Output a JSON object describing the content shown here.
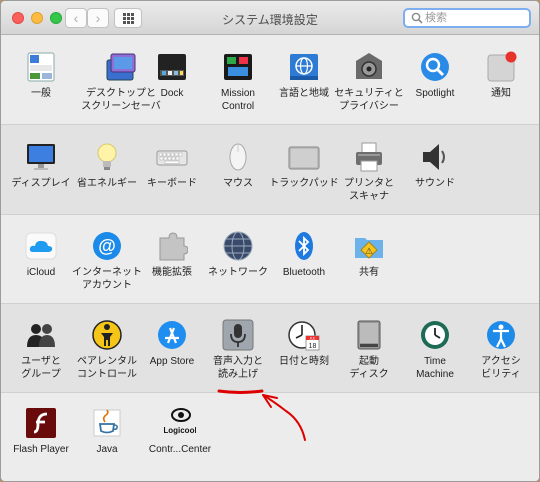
{
  "window": {
    "title": "システム環境設定"
  },
  "toolbar": {
    "back_label": "‹",
    "forward_label": "›"
  },
  "search": {
    "placeholder": "検索",
    "value": ""
  },
  "sections": [
    {
      "panes": [
        {
          "label": "一般",
          "icon": "general-icon"
        },
        {
          "label": "デスクトップと\nスクリーンセーバ",
          "icon": "desktop-screensaver-icon"
        },
        {
          "label": "Dock",
          "icon": "dock-icon"
        },
        {
          "label": "Mission\nControl",
          "icon": "mission-control-icon"
        },
        {
          "label": "言語と地域",
          "icon": "language-region-icon"
        },
        {
          "label": "セキュリティと\nプライバシー",
          "icon": "security-privacy-icon"
        },
        {
          "label": "Spotlight",
          "icon": "spotlight-icon"
        },
        {
          "label": "通知",
          "icon": "notifications-icon"
        }
      ]
    },
    {
      "panes": [
        {
          "label": "ディスプレイ",
          "icon": "displays-icon"
        },
        {
          "label": "省エネルギー",
          "icon": "energy-saver-icon"
        },
        {
          "label": "キーボード",
          "icon": "keyboard-icon"
        },
        {
          "label": "マウス",
          "icon": "mouse-icon"
        },
        {
          "label": "トラックパッド",
          "icon": "trackpad-icon"
        },
        {
          "label": "プリンタと\nスキャナ",
          "icon": "printers-scanners-icon"
        },
        {
          "label": "サウンド",
          "icon": "sound-icon"
        }
      ]
    },
    {
      "panes": [
        {
          "label": "iCloud",
          "icon": "icloud-icon"
        },
        {
          "label": "インターネット\nアカウント",
          "icon": "internet-accounts-icon"
        },
        {
          "label": "機能拡張",
          "icon": "extensions-icon"
        },
        {
          "label": "ネットワーク",
          "icon": "network-icon"
        },
        {
          "label": "Bluetooth",
          "icon": "bluetooth-icon"
        },
        {
          "label": "共有",
          "icon": "sharing-icon"
        }
      ]
    },
    {
      "panes": [
        {
          "label": "ユーザと\nグループ",
          "icon": "users-groups-icon"
        },
        {
          "label": "ペアレンタル\nコントロール",
          "icon": "parental-controls-icon"
        },
        {
          "label": "App Store",
          "icon": "app-store-icon"
        },
        {
          "label": "音声入力と\n読み上げ",
          "icon": "dictation-speech-icon"
        },
        {
          "label": "日付と時刻",
          "icon": "date-time-icon"
        },
        {
          "label": "起動\nディスク",
          "icon": "startup-disk-icon"
        },
        {
          "label": "Time\nMachine",
          "icon": "time-machine-icon"
        },
        {
          "label": "アクセシ\nビリティ",
          "icon": "accessibility-icon"
        }
      ]
    },
    {
      "panes": [
        {
          "label": "Flash Player",
          "icon": "flash-player-icon"
        },
        {
          "label": "Java",
          "icon": "java-icon"
        },
        {
          "label": "Contr...Center",
          "icon": "logicool-control-center-icon"
        }
      ]
    }
  ],
  "branding": {
    "logicool_logo_text": "Logicool"
  },
  "date_icon": {
    "month": "JUL",
    "day": "18"
  }
}
